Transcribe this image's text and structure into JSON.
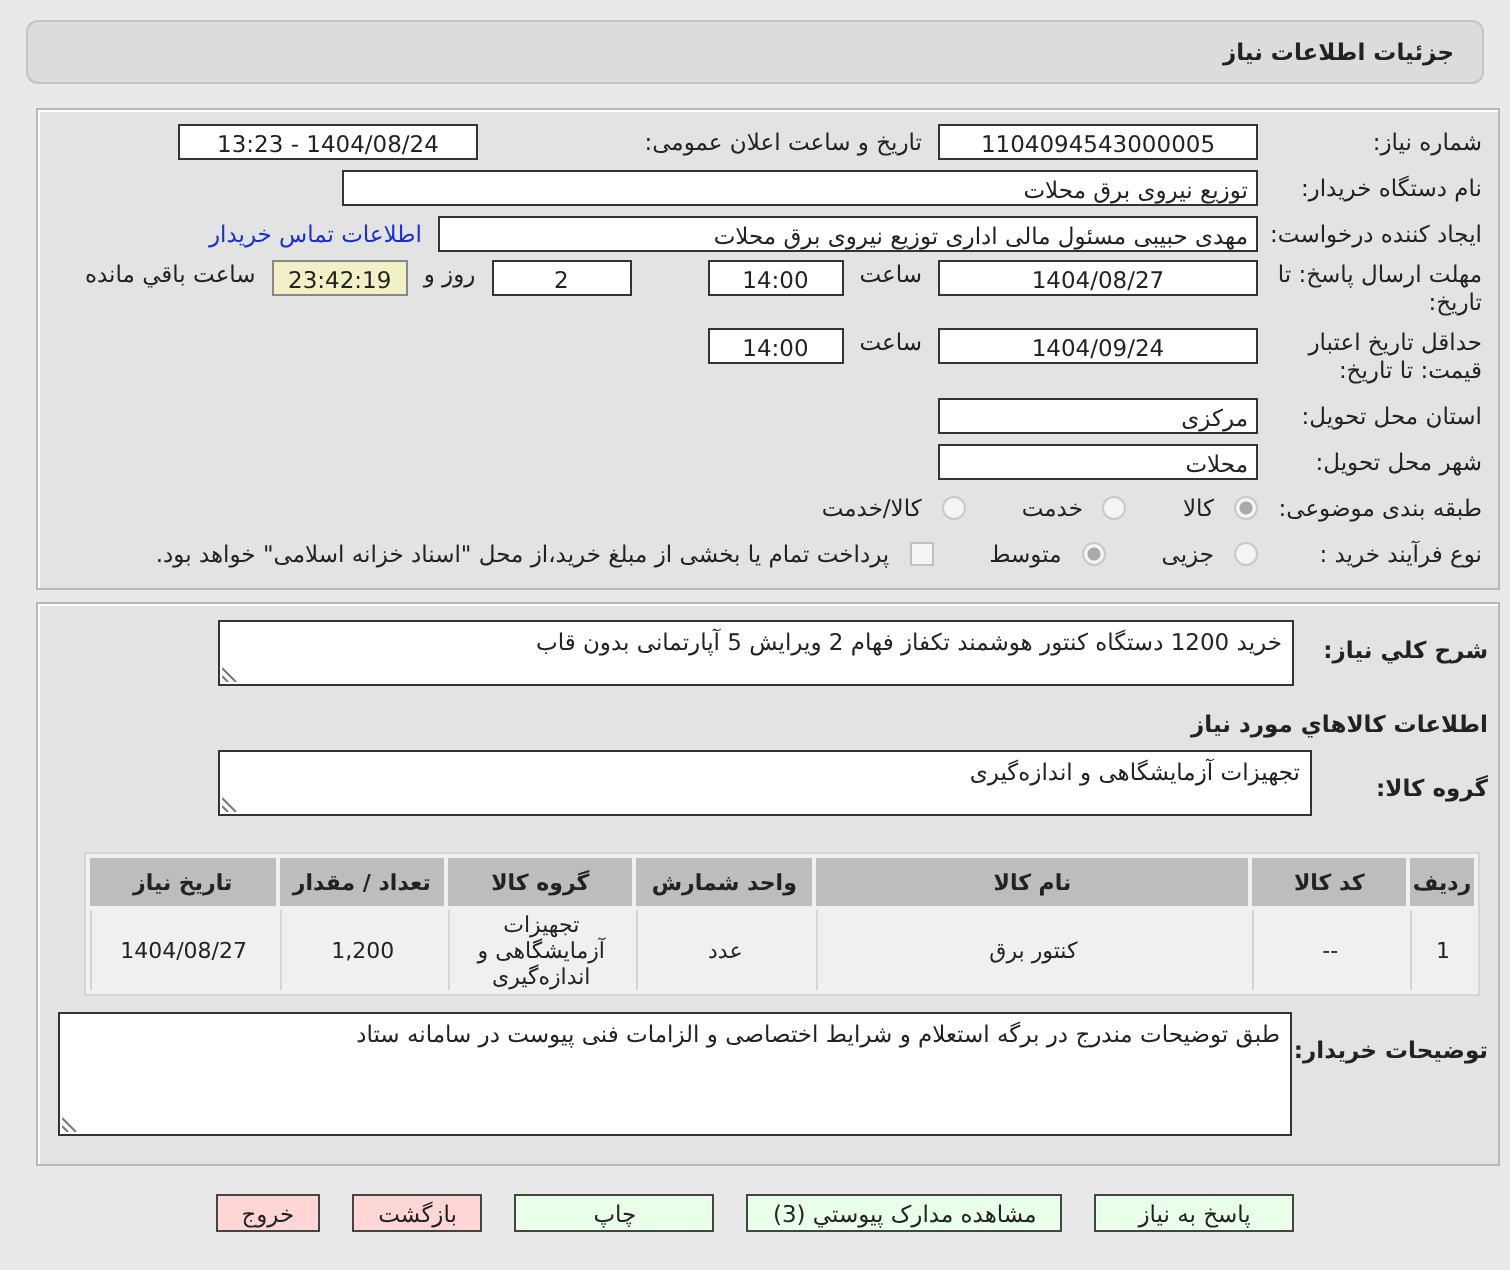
{
  "header": {
    "title": "جزئیات اطلاعات نیاز"
  },
  "need_number": {
    "label": "شماره نیاز:",
    "value": "1104094543000005"
  },
  "announce_datetime": {
    "label": "تاریخ و ساعت اعلان عمومی:",
    "value": "1404/08/24 - 13:23"
  },
  "buyer_org": {
    "label": "نام دستگاه خریدار:",
    "value": "توزیع نیروی برق محلات"
  },
  "requester": {
    "label": "ایجاد کننده درخواست:",
    "value": "مهدی  حبیبی مسئول مالی اداری توزیع نیروی برق محلات",
    "link": "اطلاعات تماس خریدار"
  },
  "response_deadline": {
    "label": "مهلت ارسال پاسخ: تا تاریخ:",
    "date": "1404/08/27",
    "time_label": "ساعت",
    "time": "14:00",
    "days": "2",
    "days_label": "روز و",
    "remaining": "23:42:19",
    "remaining_label": "ساعت باقي مانده"
  },
  "price_validity": {
    "label": "حداقل تاریخ اعتبار قیمت: تا تاریخ:",
    "date": "1404/09/24",
    "time_label": "ساعت",
    "time": "14:00"
  },
  "province": {
    "label": "استان محل تحویل:",
    "value": "مرکزی"
  },
  "city": {
    "label": "شهر محل تحویل:",
    "value": "محلات"
  },
  "category": {
    "label": "طبقه بندی موضوعی:",
    "options": [
      {
        "label": "کالا",
        "selected": true
      },
      {
        "label": "خدمت",
        "selected": false
      },
      {
        "label": "کالا/خدمت",
        "selected": false
      }
    ]
  },
  "purchase_type": {
    "label": "نوع فرآیند خرید :",
    "options": [
      {
        "label": "جزیی",
        "selected": false
      },
      {
        "label": "متوسط",
        "selected": true
      }
    ],
    "treasury": {
      "checked": false,
      "text": "پرداخت تمام یا بخشی از مبلغ خرید،از محل \"اسناد خزانه اسلامی\" خواهد بود."
    }
  },
  "description": {
    "label": "شرح کلي نیاز:",
    "value": "خرید 1200 دستگاه کنتور هوشمند تکفاز فهام 2 ویرایش 5 آپارتمانی بدون قاب"
  },
  "goods_heading": "اطلاعات کالاهاي مورد نیاز",
  "goods_group": {
    "label": "گروه کالا:",
    "value": "تجهیزات آزمایشگاهی و اندازه‌گیری"
  },
  "table": {
    "columns": [
      "ردیف",
      "کد کالا",
      "نام کالا",
      "واحد شمارش",
      "گروه کالا",
      "تعداد / مقدار",
      "تاریخ نیاز"
    ],
    "rows": [
      [
        "1",
        "--",
        "کنتور برق",
        "عدد",
        "تجهیزات آزمایشگاهی و اندازه‌گیری",
        "1,200",
        "1404/08/27"
      ]
    ]
  },
  "buyer_notes": {
    "label": "توضیحات خریدار:",
    "value": "طبق توضیحات مندرج در برگه استعلام و شرایط اختصاصی و الزامات فنی پیوست در سامانه ستاد"
  },
  "buttons": [
    {
      "label": "پاسخ به نیاز",
      "kind": "normal"
    },
    {
      "label": "مشاهده مدارک پیوستي (3)",
      "kind": "normal"
    },
    {
      "label": "چاپ",
      "kind": "normal"
    },
    {
      "label": "بازگشت",
      "kind": "danger"
    },
    {
      "label": "خروج",
      "kind": "danger"
    }
  ]
}
